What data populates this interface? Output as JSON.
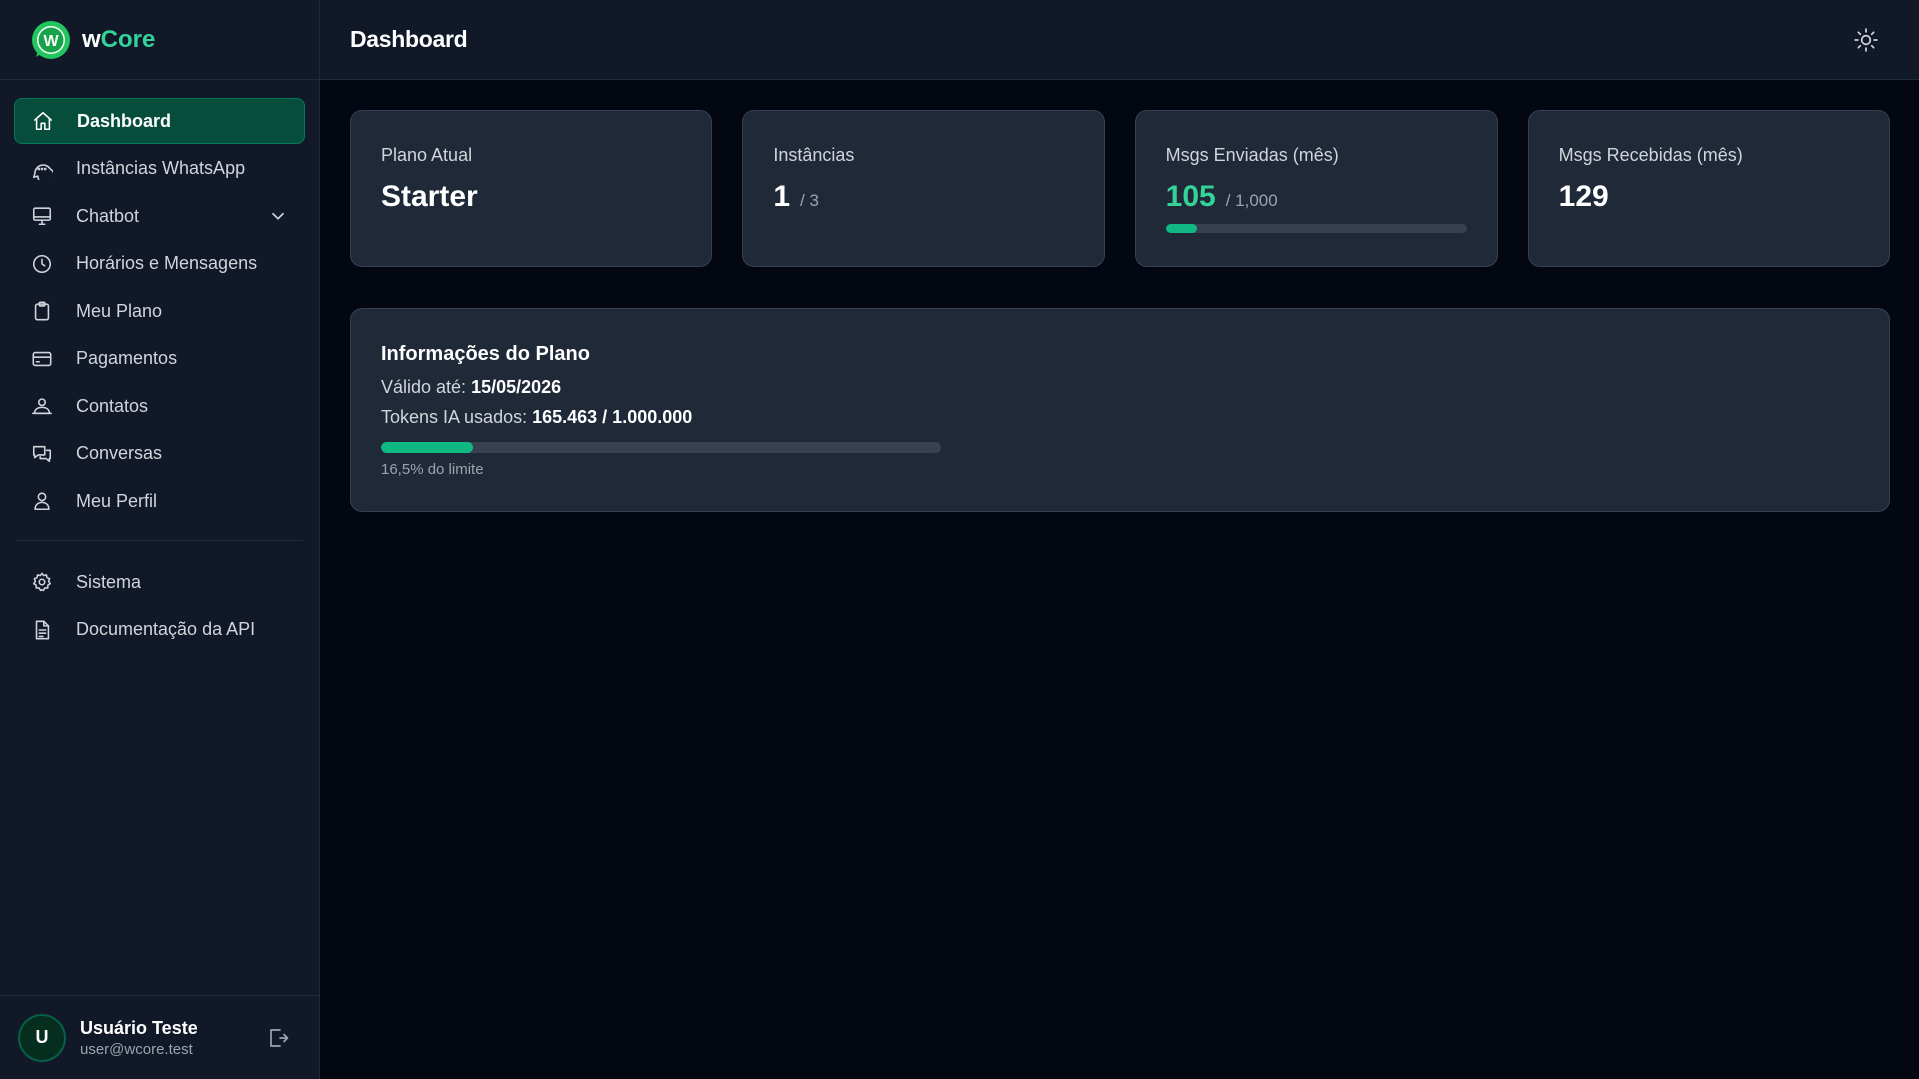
{
  "brand": {
    "name_prefix": "w",
    "name_rest": "Core",
    "logo_letter": "W",
    "accent": "#34d399"
  },
  "sidebar": {
    "items": [
      {
        "label": "Dashboard",
        "icon": "home-icon",
        "active": true
      },
      {
        "label": "Instâncias WhatsApp",
        "icon": "message-circle-icon"
      },
      {
        "label": "Chatbot",
        "icon": "monitor-icon",
        "has_chevron": true
      },
      {
        "label": "Horários e Mensagens",
        "icon": "clock-icon"
      },
      {
        "label": "Meu Plano",
        "icon": "clipboard-icon"
      },
      {
        "label": "Pagamentos",
        "icon": "credit-card-icon"
      },
      {
        "label": "Contatos",
        "icon": "users-icon"
      },
      {
        "label": "Conversas",
        "icon": "chat-bubbles-icon"
      },
      {
        "label": "Meu Perfil",
        "icon": "user-icon"
      }
    ],
    "secondary_items": [
      {
        "label": "Sistema",
        "icon": "gear-icon"
      },
      {
        "label": "Documentação da API",
        "icon": "document-icon"
      }
    ]
  },
  "user": {
    "initial": "U",
    "name": "Usuário Teste",
    "email": "user@wcore.test"
  },
  "header": {
    "title": "Dashboard",
    "theme_icon": "sun-icon"
  },
  "stats": {
    "plan": {
      "label": "Plano Atual",
      "value": "Starter"
    },
    "instances": {
      "label": "Instâncias",
      "value": "1",
      "limit": "/ 3"
    },
    "sent": {
      "label": "Msgs Enviadas (mês)",
      "value": "105",
      "limit": "/ 1,000",
      "progress_fraction": 0.105
    },
    "received": {
      "label": "Msgs Recebidas (mês)",
      "value": "129"
    }
  },
  "plan_info": {
    "title": "Informações do Plano",
    "valid_label": "Válido até:",
    "valid_value": "15/05/2026",
    "tokens_label": "Tokens IA usados:",
    "tokens_value": "165.463 / 1.000.000",
    "tokens_fraction": 0.165,
    "note": "16,5% do limite"
  },
  "colors": {
    "accent": "#10b981",
    "background": "#030712",
    "surface": "#1f2937"
  }
}
